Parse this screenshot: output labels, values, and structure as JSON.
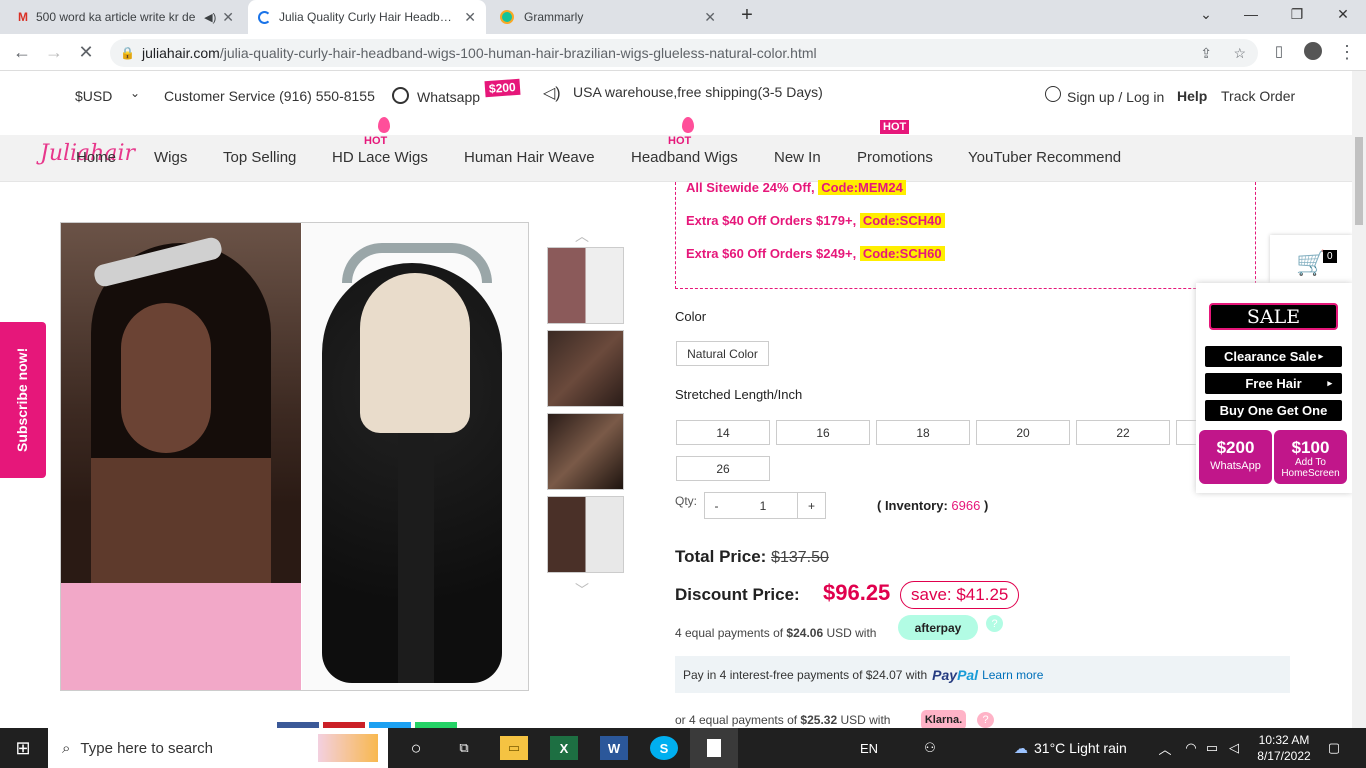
{
  "browser": {
    "tabs": [
      {
        "title": "500 word ka article write kr de",
        "icon": "gmail-icon"
      },
      {
        "title": "Julia Quality Curly Hair Headband",
        "icon": "loading-spinner-icon"
      },
      {
        "title": "Grammarly",
        "icon": "grammarly-icon"
      }
    ],
    "new_tab": "+",
    "url_host": "juliahair.com",
    "url_path": "/julia-quality-curly-hair-headband-wigs-100-human-hair-brazilian-wigs-glueless-natural-color.html"
  },
  "topstrip": {
    "currency": "$USD",
    "customer_service": "Customer Service (916) 550-8155",
    "whatsapp": "Whatsapp",
    "whatsapp_badge": "$200",
    "shipping": "USA warehouse,free shipping(3-5 Days)",
    "signup": "Sign up / Log in",
    "help": "Help",
    "track": "Track Order"
  },
  "nav": {
    "logo": "Juliahair",
    "items": [
      "Home",
      "Wigs",
      "Top Selling",
      "HD Lace Wigs",
      "Human Hair Weave",
      "Headband Wigs",
      "New In",
      "Promotions",
      "YouTuber Recommend"
    ],
    "hot_label": "HOT"
  },
  "promos": [
    {
      "text": "All Sitewide 24% Off,",
      "code": "Code:MEM24"
    },
    {
      "text": "Extra $40 Off Orders $179+,",
      "code": "Code:SCH40"
    },
    {
      "text": "Extra $60 Off Orders $249+,",
      "code": "Code:SCH60"
    }
  ],
  "product": {
    "color_label": "Color",
    "color_value": "Natural Color",
    "length_label": "Stretched Length/Inch",
    "lengths": [
      "14",
      "16",
      "18",
      "20",
      "22",
      "26"
    ],
    "qty_label": "Qty:",
    "qty_minus": "-",
    "qty_value": "1",
    "qty_plus": "+",
    "inventory_prefix": "( Inventory:",
    "inventory_value": "6966",
    "inventory_suffix": ")",
    "total_label": "Total Price:",
    "total_value": "$137.50",
    "discount_label": "Discount Price:",
    "discount_value": "$96.25",
    "save_text": "save: $41.25",
    "afterpay_prefix": "4 equal payments of",
    "afterpay_amount": "$24.06",
    "afterpay_suffix": "USD with",
    "afterpay_brand": "afterpay",
    "paypal_text": "Pay in 4 interest-free payments of $24.07 with",
    "paypal_brand_pay": "Pay",
    "paypal_brand_pal": "Pal",
    "paypal_link": "Learn more",
    "klarna_prefix": "or 4 equal payments of",
    "klarna_amount": "$25.32",
    "klarna_suffix": "USD with",
    "klarna_brand": "Klarna.",
    "help_q": "?"
  },
  "side": {
    "subscribe": "Subscribe now!",
    "cart_count": "0",
    "sale": "SALE",
    "clearance": "Clearance Sale",
    "free_hair": "Free Hair",
    "bogo": "Buy One Get One",
    "wa_amount": "$200",
    "wa_label": "WhatsApp",
    "home_amount": "$100",
    "home_label1": "Add To",
    "home_label2": "HomeScreen"
  },
  "taskbar": {
    "search": "Type here to search",
    "lang": "EN",
    "weather": "31°C  Light rain",
    "time": "10:32 AM",
    "date": "8/17/2022"
  },
  "colors": {
    "accent": "#e6177a",
    "price": "#e0004d"
  }
}
